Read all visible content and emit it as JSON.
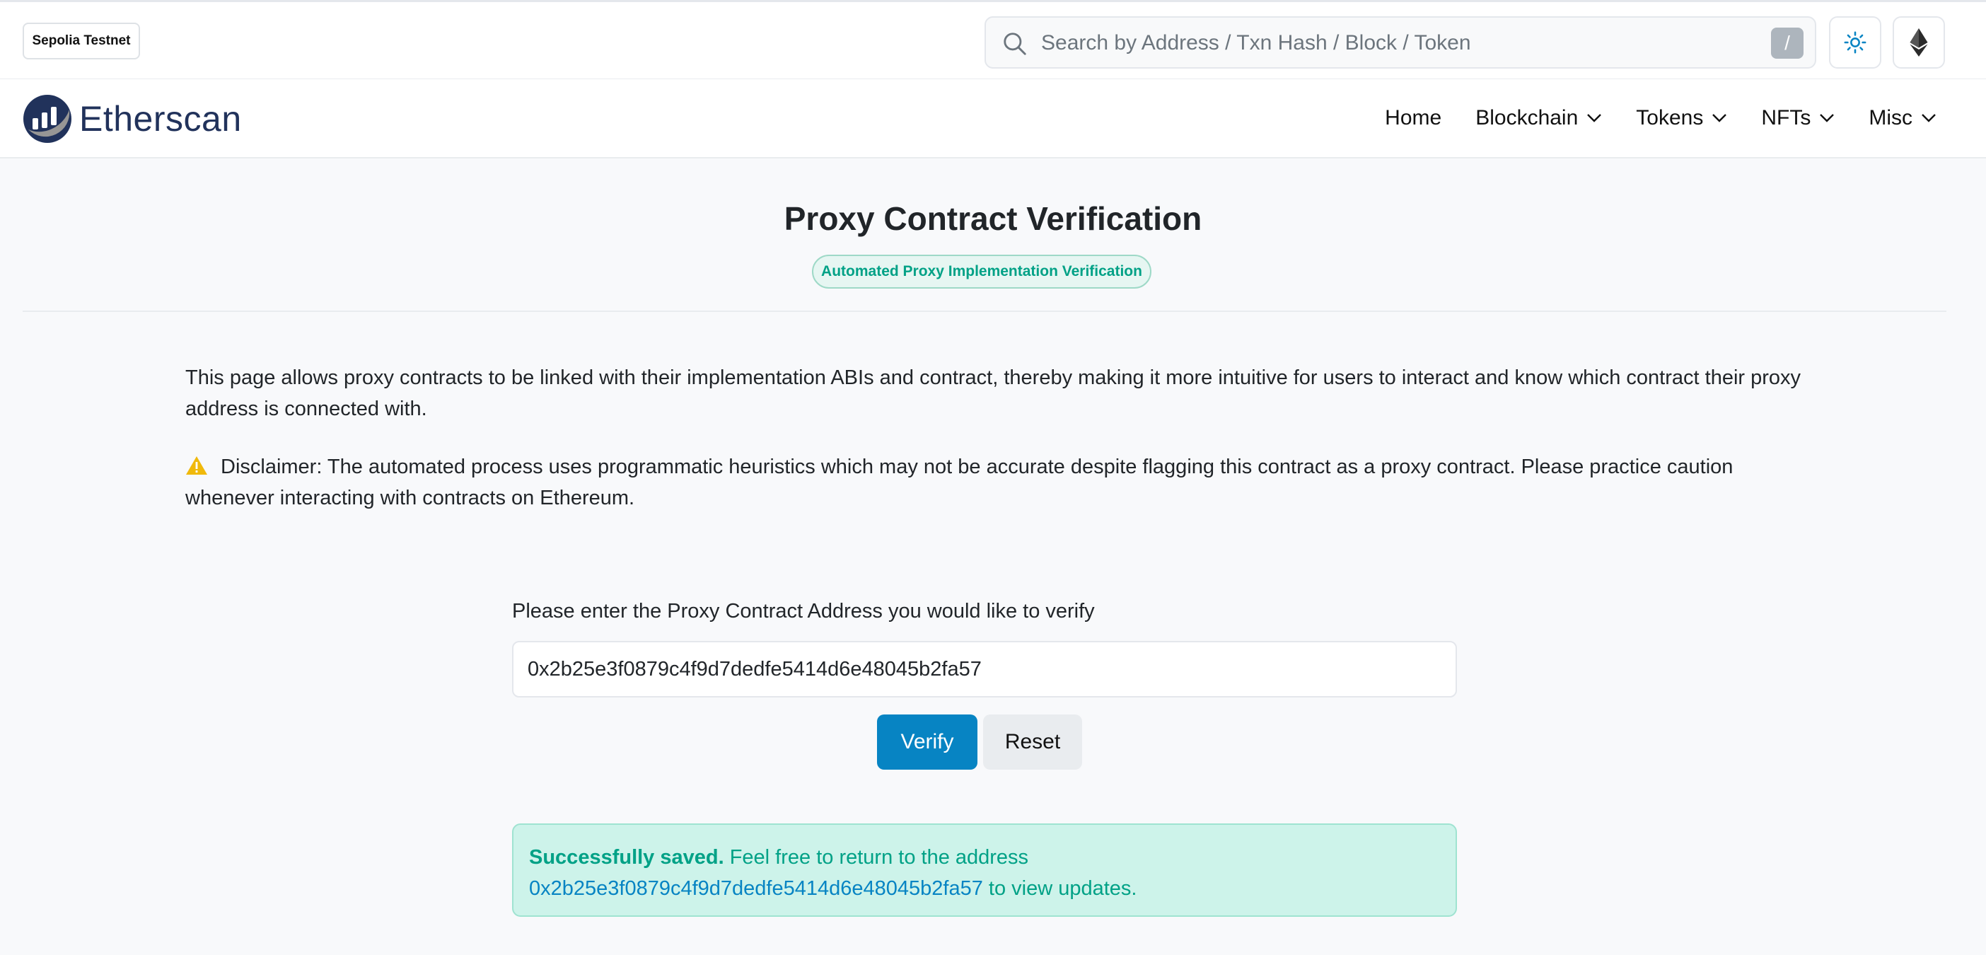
{
  "topbar": {
    "network_label": "Sepolia Testnet",
    "search_placeholder": "Search by Address / Txn Hash / Block / Token",
    "search_shortcut": "/"
  },
  "brand": {
    "name": "Etherscan"
  },
  "nav": {
    "items": [
      {
        "label": "Home",
        "has_dropdown": false
      },
      {
        "label": "Blockchain",
        "has_dropdown": true
      },
      {
        "label": "Tokens",
        "has_dropdown": true
      },
      {
        "label": "NFTs",
        "has_dropdown": true
      },
      {
        "label": "Misc",
        "has_dropdown": true
      }
    ]
  },
  "page": {
    "title": "Proxy Contract Verification",
    "badge": "Automated Proxy Implementation Verification",
    "intro": "This page allows proxy contracts to be linked with their implementation ABIs and contract, thereby making it more intuitive for users to interact and know which contract their proxy address is connected with.",
    "disclaimer": "Disclaimer: The automated process uses programmatic heuristics which may not be accurate despite flagging this contract as a proxy contract. Please practice caution whenever interacting with contracts on Ethereum."
  },
  "form": {
    "label": "Please enter the Proxy Contract Address you would like to verify",
    "address_value": "0x2b25e3f0879c4f9d7dedfe5414d6e48045b2fa57",
    "verify_label": "Verify",
    "reset_label": "Reset"
  },
  "alert": {
    "strong": "Successfully saved.",
    "text_before_link": " Feel free to return to the address",
    "link_text": "0x2b25e3f0879c4f9d7dedfe5414d6e48045b2fa57",
    "text_after_link": " to view updates."
  },
  "colors": {
    "primary": "#0784c3",
    "success_text": "#00a186",
    "success_bg": "#cdf3ea",
    "brand_navy": "#21325b",
    "warning": "#f0b90b"
  }
}
